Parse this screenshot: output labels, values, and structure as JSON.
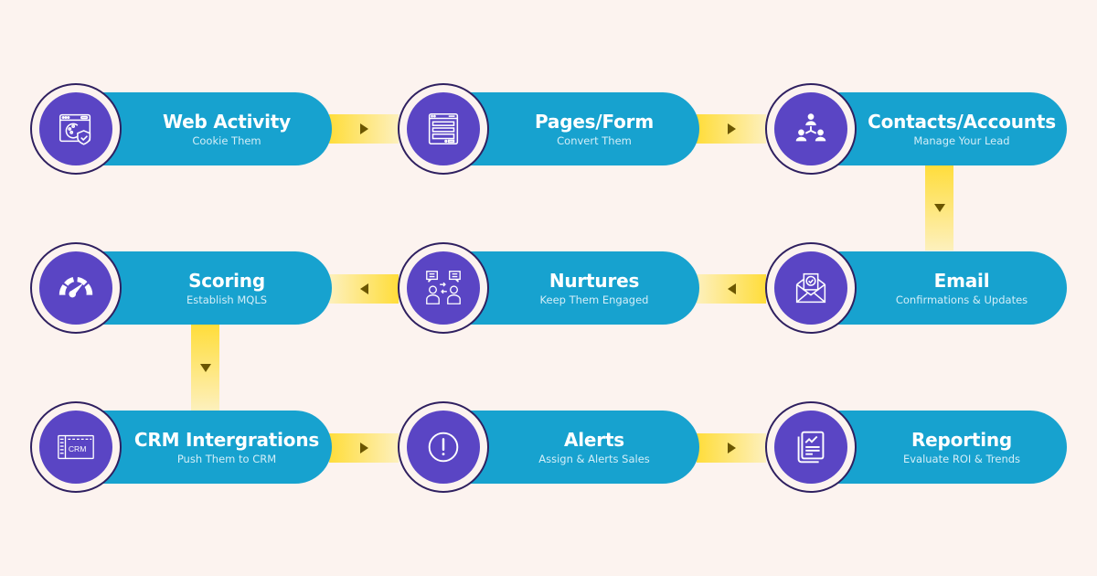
{
  "colors": {
    "background": "#fcf3ef",
    "pill": "#17a2cf",
    "icon_disc": "#5a45c4",
    "ring_border": "#2f2060",
    "connector": "#ffdd3a",
    "arrow": "#6b5600"
  },
  "steps": [
    {
      "title": "Web Activity",
      "subtitle": "Cookie Them",
      "icon": "cookie-browser-shield-icon"
    },
    {
      "title": "Pages/Form",
      "subtitle": "Convert Them",
      "icon": "web-form-icon"
    },
    {
      "title": "Contacts/Accounts",
      "subtitle": "Manage Your Lead",
      "icon": "contacts-network-icon"
    },
    {
      "title": "Email",
      "subtitle": "Confirmations & Updates",
      "icon": "email-check-icon"
    },
    {
      "title": "Nurtures",
      "subtitle": "Keep Them Engaged",
      "icon": "conversation-exchange-icon"
    },
    {
      "title": "Scoring",
      "subtitle": "Establish MQLS",
      "icon": "speedometer-icon"
    },
    {
      "title": "CRM Intergrations",
      "subtitle": "Push Them to CRM",
      "icon": "crm-window-icon"
    },
    {
      "title": "Alerts",
      "subtitle": "Assign & Alerts Sales",
      "icon": "alert-exclamation-icon"
    },
    {
      "title": "Reporting",
      "subtitle": "Evaluate ROI & Trends",
      "icon": "report-chart-icon"
    }
  ],
  "flow": [
    {
      "from": "Web Activity",
      "to": "Pages/Form",
      "direction": "right"
    },
    {
      "from": "Pages/Form",
      "to": "Contacts/Accounts",
      "direction": "right"
    },
    {
      "from": "Contacts/Accounts",
      "to": "Email",
      "direction": "down"
    },
    {
      "from": "Email",
      "to": "Nurtures",
      "direction": "left"
    },
    {
      "from": "Nurtures",
      "to": "Scoring",
      "direction": "left"
    },
    {
      "from": "Scoring",
      "to": "CRM Intergrations",
      "direction": "down"
    },
    {
      "from": "CRM Intergrations",
      "to": "Alerts",
      "direction": "right"
    },
    {
      "from": "Alerts",
      "to": "Reporting",
      "direction": "right"
    }
  ]
}
